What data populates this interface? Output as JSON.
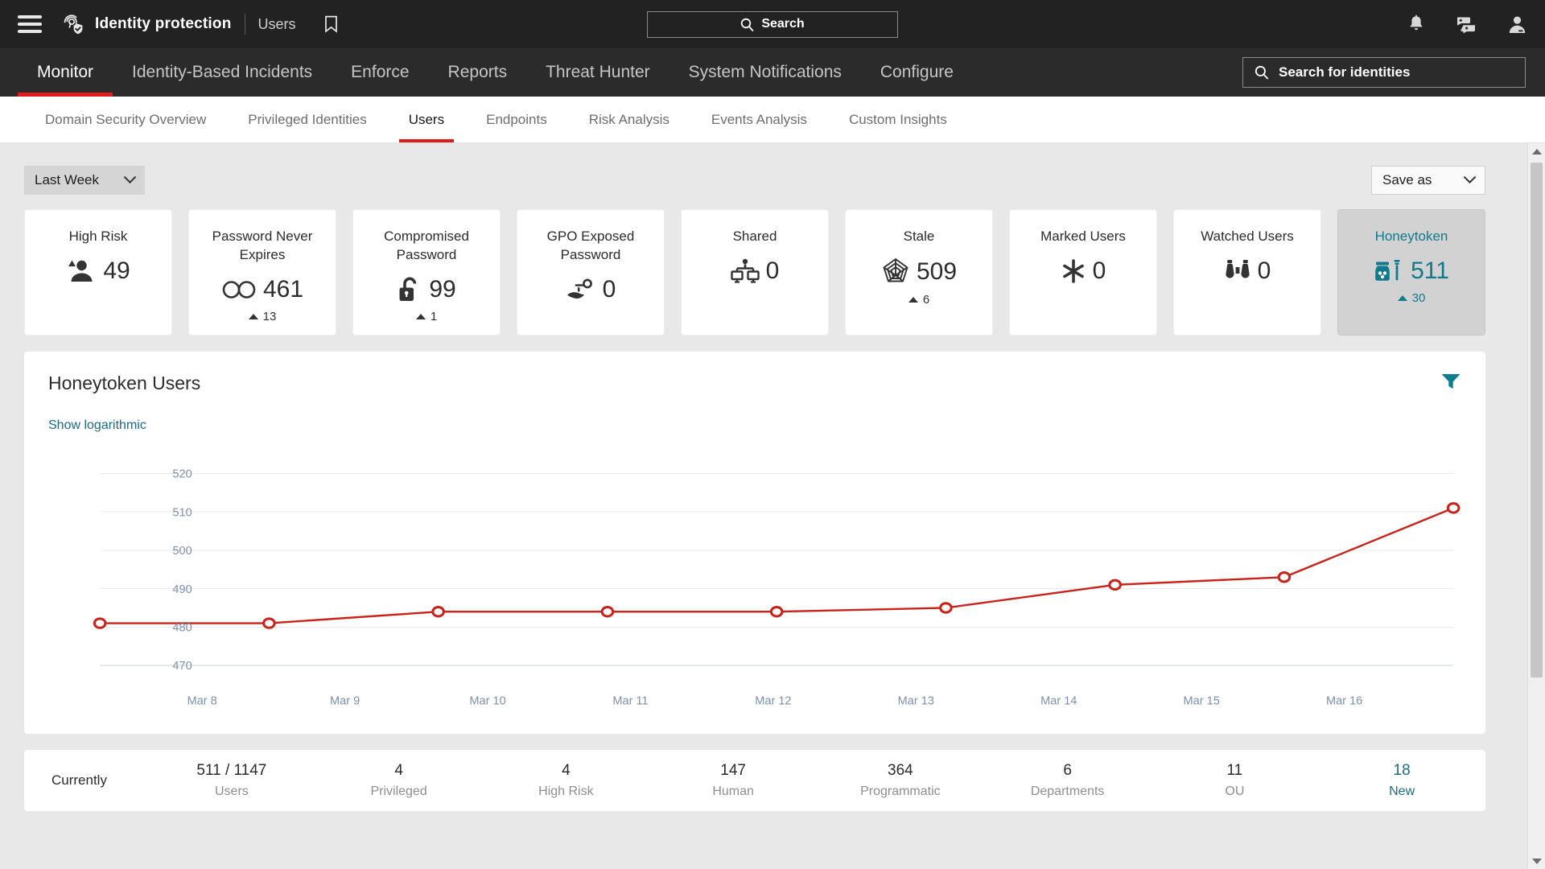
{
  "header": {
    "menu_icon": "hamburger-icon",
    "logo_icon": "fingerprint-shield-icon",
    "app_title": "Identity protection",
    "section": "Users",
    "bookmark_icon": "bookmark-icon",
    "search_placeholder": "Search",
    "search_icon": "search-icon",
    "notifications_icon": "bell-icon",
    "messages_icon": "chat-icon",
    "account_icon": "user-avatar-icon"
  },
  "nav": {
    "items": [
      {
        "label": "Monitor",
        "active": true
      },
      {
        "label": "Identity-Based Incidents",
        "active": false
      },
      {
        "label": "Enforce",
        "active": false
      },
      {
        "label": "Reports",
        "active": false
      },
      {
        "label": "Threat Hunter",
        "active": false
      },
      {
        "label": "System Notifications",
        "active": false
      },
      {
        "label": "Configure",
        "active": false
      }
    ],
    "identity_search_placeholder": "Search for identities"
  },
  "subtabs": [
    {
      "label": "Domain Security Overview",
      "active": false
    },
    {
      "label": "Privileged Identities",
      "active": false
    },
    {
      "label": "Users",
      "active": true
    },
    {
      "label": "Endpoints",
      "active": false
    },
    {
      "label": "Risk Analysis",
      "active": false
    },
    {
      "label": "Events Analysis",
      "active": false
    },
    {
      "label": "Custom Insights",
      "active": false
    }
  ],
  "toolbar": {
    "range_value": "Last Week",
    "save_as_label": "Save as"
  },
  "cards": [
    {
      "title": "High Risk",
      "value": "49",
      "delta": null,
      "icon": "user-warning-icon",
      "selected": false
    },
    {
      "title": "Password Never Expires",
      "value": "461",
      "delta": "13",
      "icon": "infinity-icon",
      "selected": false
    },
    {
      "title": "Compromised Password",
      "value": "99",
      "delta": "1",
      "icon": "unlocked-padlock-icon",
      "selected": false
    },
    {
      "title": "GPO Exposed Password",
      "value": "0",
      "delta": null,
      "icon": "hand-key-icon",
      "selected": false
    },
    {
      "title": "Shared",
      "value": "0",
      "delta": null,
      "icon": "shared-workstations-icon",
      "selected": false
    },
    {
      "title": "Stale",
      "value": "509",
      "delta": "6",
      "icon": "spider-web-icon",
      "selected": false
    },
    {
      "title": "Marked Users",
      "value": "0",
      "delta": null,
      "icon": "asterisk-icon",
      "selected": false
    },
    {
      "title": "Watched Users",
      "value": "0",
      "delta": null,
      "icon": "binoculars-icon",
      "selected": false
    },
    {
      "title": "Honeytoken",
      "value": "511",
      "delta": "30",
      "icon": "honeypot-icon",
      "selected": true
    }
  ],
  "panel": {
    "title": "Honeytoken Users",
    "log_toggle": "Show logarithmic",
    "filter_icon": "funnel-filter-icon",
    "accent_color": "#cc2118"
  },
  "chart_data": {
    "type": "line",
    "title": "Honeytoken Users",
    "xlabel": "",
    "ylabel": "",
    "x": [
      "Mar 8",
      "Mar 9",
      "Mar 10",
      "Mar 11",
      "Mar 12",
      "Mar 13",
      "Mar 14",
      "Mar 15",
      "Mar 16"
    ],
    "series": [
      {
        "name": "Honeytoken Users",
        "color": "#cc2118",
        "values": [
          481,
          481,
          484,
          484,
          484,
          485,
          491,
          493,
          511
        ]
      }
    ],
    "yticks": [
      470,
      480,
      490,
      500,
      510,
      520
    ],
    "ylim": [
      466,
      524
    ],
    "grid": true,
    "legend": "none",
    "marker": "open-circle"
  },
  "summary": {
    "label": "Currently",
    "cells": [
      {
        "value": "511 / 1147",
        "key": "Users",
        "highlight": false
      },
      {
        "value": "4",
        "key": "Privileged",
        "highlight": false
      },
      {
        "value": "4",
        "key": "High Risk",
        "highlight": false
      },
      {
        "value": "147",
        "key": "Human",
        "highlight": false
      },
      {
        "value": "364",
        "key": "Programmatic",
        "highlight": false
      },
      {
        "value": "6",
        "key": "Departments",
        "highlight": false
      },
      {
        "value": "11",
        "key": "OU",
        "highlight": false
      },
      {
        "value": "18",
        "key": "New",
        "highlight": true
      }
    ]
  }
}
